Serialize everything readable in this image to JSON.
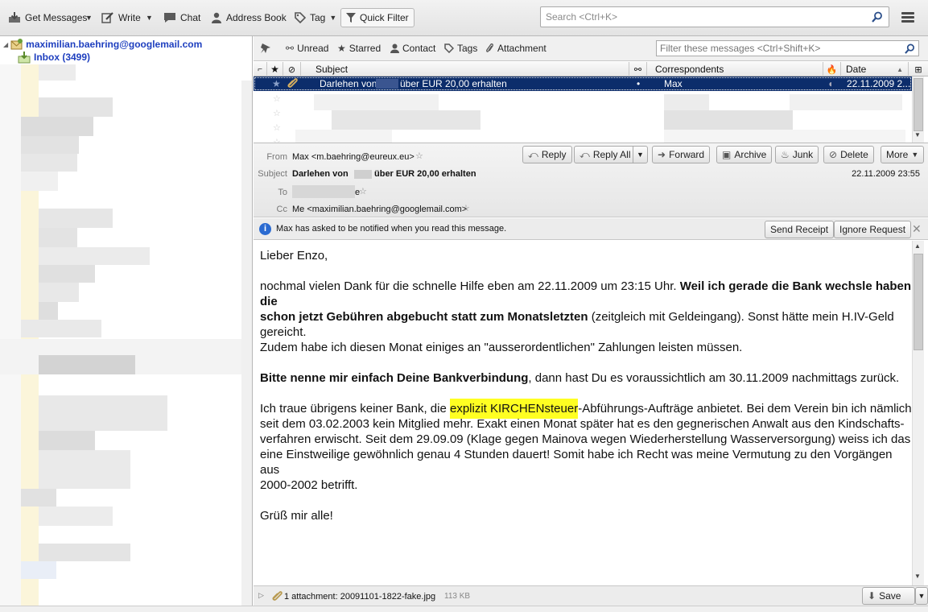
{
  "toolbar": {
    "get_messages": "Get Messages",
    "write": "Write",
    "chat": "Chat",
    "address_book": "Address Book",
    "tag": "Tag",
    "quick_filter": "Quick Filter",
    "search_placeholder": "Search <Ctrl+K>"
  },
  "folders": {
    "account": "maximilian.baehring@googlemail.com",
    "inbox": "Inbox (3499)"
  },
  "quick_filter_bar": {
    "unread": "Unread",
    "starred": "Starred",
    "contact": "Contact",
    "tags": "Tags",
    "attachment": "Attachment",
    "filter_placeholder": "Filter these messages <Ctrl+Shift+K>"
  },
  "thread_columns": {
    "subject": "Subject",
    "correspondents": "Correspondents",
    "date": "Date"
  },
  "thread_rows": [
    {
      "subject_prefix": "Darlehen von",
      "subject_suffix": "über EUR 20,00 erhalten",
      "correspondent": "Max",
      "date": "22.11.2009 2..."
    }
  ],
  "header": {
    "from_label": "From",
    "from_value": "Max <m.baehring@eureux.eu>",
    "subject_label": "Subject",
    "subject_prefix": "Darlehen von",
    "subject_suffix": "über EUR 20,00 erhalten",
    "to_label": "To",
    "to_suffix": "e",
    "cc_label": "Cc",
    "cc_value": "Me <maximilian.baehring@googlemail.com>",
    "date": "22.11.2009 23:55",
    "reply": "Reply",
    "reply_all": "Reply All",
    "forward": "Forward",
    "archive": "Archive",
    "junk": "Junk",
    "delete": "Delete",
    "more": "More"
  },
  "notification": {
    "text": "Max has asked to be notified when you read this message.",
    "send_receipt": "Send Receipt",
    "ignore_request": "Ignore Request"
  },
  "body": {
    "greeting": "Lieber Enzo,",
    "p1_a": "nochmal vielen Dank für die schnelle Hilfe eben am 22.11.2009 um 23:15 Uhr. ",
    "p1_b": "Weil ich gerade die Bank wechsle haben die",
    "p1_c": "schon jetzt Gebühren abgebucht statt zum Monatsletzten",
    "p1_d": " (zeitgleich mit Geldeingang). Sonst hätte mein H.IV-Geld gereicht.",
    "p1_e": "Zudem habe ich diesen Monat einiges an \"ausserordentlichen\" Zahlungen leisten müssen.",
    "p2_a": "Bitte nenne mir einfach Deine Bankverbindung",
    "p2_b": ", dann hast Du es voraussichtlich am 30.11.2009 nachmittags zurück.",
    "p3_a": "Ich traue übrigens keiner Bank, die ",
    "p3_hl": "explizit KIRCHENsteuer",
    "p3_b": "-Abführungs-Aufträge anbietet. Bei dem Verein bin ich nämlich",
    "p3_c": "seit dem 03.02.2003 kein Mitglied mehr. Exakt einen Monat später hat es den gegnerischen Anwalt aus den Kindschafts-",
    "p3_d": "verfahren erwischt. Seit dem 29.09.09 (Klage gegen Mainova wegen Wiederherstellung Wasserversorgung) weiss ich das",
    "p3_e": "eine Einstweilige gewöhnlich genau 4 Stunden dauert! Somit habe ich Recht was meine Vermutung zu den Vorgängen aus",
    "p3_f": "2000-2002 betrifft.",
    "closing": "Grüß mir alle!"
  },
  "attachment": {
    "label": "1 attachment: 20091101-1822-fake.jpg",
    "size": "113 KB",
    "save": "Save"
  }
}
